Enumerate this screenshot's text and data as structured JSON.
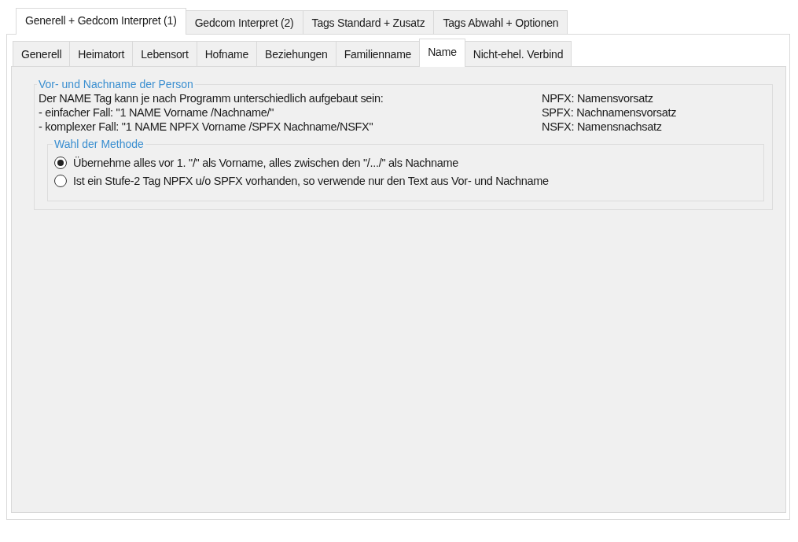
{
  "outer_tabs": [
    {
      "label": "Generell + Gedcom Interpret (1)",
      "selected": true
    },
    {
      "label": "Gedcom Interpret (2)",
      "selected": false
    },
    {
      "label": "Tags Standard + Zusatz",
      "selected": false
    },
    {
      "label": "Tags Abwahl + Optionen",
      "selected": false
    }
  ],
  "inner_tabs": [
    {
      "label": "Generell",
      "selected": false
    },
    {
      "label": "Heimatort",
      "selected": false
    },
    {
      "label": "Lebensort",
      "selected": false
    },
    {
      "label": "Hofname",
      "selected": false
    },
    {
      "label": "Beziehungen",
      "selected": false
    },
    {
      "label": "Familienname",
      "selected": false
    },
    {
      "label": "Name",
      "selected": true
    },
    {
      "label": "Nicht-ehel. Verbind",
      "selected": false
    }
  ],
  "group": {
    "title": "Vor- und Nachname der Person",
    "lines": [
      {
        "text": "Der NAME Tag kann je nach Programm unterschiedlich aufgebaut sein:",
        "note": "NPFX: Namensvorsatz"
      },
      {
        "text": "- einfacher Fall: \"1 NAME Vorname /Nachname/\"",
        "note": "SPFX: Nachnamensvorsatz"
      },
      {
        "text": "- komplexer Fall: \"1 NAME NPFX Vorname /SPFX Nachname/NSFX\"",
        "note": "NSFX: Namensnachsatz"
      }
    ],
    "method": {
      "title": "Wahl der Methode",
      "options": [
        {
          "label": "Übernehme alles vor 1. \"/\" als Vorname, alles zwischen den \"/.../\" als Nachname",
          "selected": true
        },
        {
          "label": "Ist ein Stufe-2 Tag NPFX u/o SPFX vorhanden, so verwende nur den Text aus Vor- und Nachname",
          "selected": false
        }
      ]
    }
  }
}
